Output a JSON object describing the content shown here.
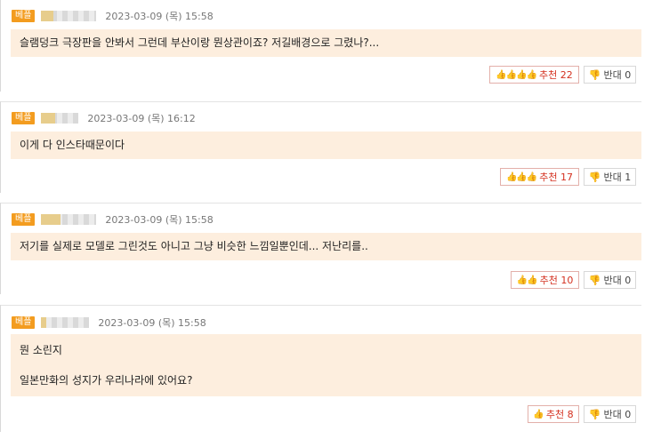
{
  "comments": [
    {
      "badge": "베플",
      "date": "2023-03-09 (목) 15:58",
      "lines": [
        "슬램덩크 극장판을 안봐서 그런데 부산이랑 뭔상관이죠?  저길배경으로 그렸나?..."
      ],
      "up_icons": "👍👍👍👍",
      "up_label": "추천",
      "up_count": "22",
      "down_label": "반대",
      "down_count": "0"
    },
    {
      "badge": "베플",
      "date": "2023-03-09 (목) 16:12",
      "lines": [
        "이게 다 인스타때문이다"
      ],
      "up_icons": "👍👍👍",
      "up_label": "추천",
      "up_count": "17",
      "down_label": "반대",
      "down_count": "1"
    },
    {
      "badge": "베플",
      "date": "2023-03-09 (목) 15:58",
      "lines": [
        "저기를 실제로 모델로 그린것도 아니고 그냥 비슷한 느낌일뿐인데...  저난리를.."
      ],
      "up_icons": "👍👍",
      "up_label": "추천",
      "up_count": "10",
      "down_label": "반대",
      "down_count": "0"
    },
    {
      "badge": "베플",
      "date": "2023-03-09 (목) 15:58",
      "lines": [
        "뭔 소린지",
        "",
        "일본만화의 성지가 우리나라에 있어요?"
      ],
      "up_icons": "👍",
      "up_label": "추천",
      "up_count": "8",
      "down_label": "반대",
      "down_count": "0"
    }
  ]
}
